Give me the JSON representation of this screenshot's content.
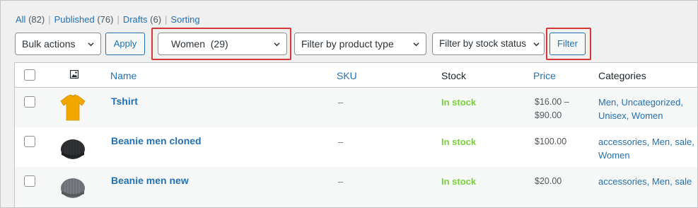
{
  "status_links": {
    "all": {
      "label": "All",
      "count": "(82)"
    },
    "published": {
      "label": "Published",
      "count": "(76)"
    },
    "drafts": {
      "label": "Drafts",
      "count": "(6)"
    },
    "sorting": {
      "label": "Sorting"
    },
    "separator": "|"
  },
  "toolbar": {
    "bulk_actions": "Bulk actions",
    "apply": "Apply",
    "category_filter": "Women  (29)",
    "product_type_filter": "Filter by product type",
    "stock_status_filter": "Filter by stock status",
    "filter": "Filter"
  },
  "table": {
    "headers": {
      "name": "Name",
      "sku": "SKU",
      "stock": "Stock",
      "price": "Price",
      "categories": "Categories"
    },
    "rows": [
      {
        "name": "Tshirt",
        "sku": "–",
        "stock": "In stock",
        "price_line1": "$16.00 –",
        "price_line2": "$90.00",
        "categories_line1": "Men, Uncategorized,",
        "categories_line2": "Unisex, Women",
        "thumb": "tshirt-thumbnail"
      },
      {
        "name": "Beanie men cloned",
        "sku": "–",
        "stock": "In stock",
        "price_line1": "$100.00",
        "price_line2": "",
        "categories_line1": "accessories, Men, sale,",
        "categories_line2": "Women",
        "thumb": "beanie-dark-thumbnail"
      },
      {
        "name": "Beanie men new",
        "sku": "–",
        "stock": "In stock",
        "price_line1": "$20.00",
        "price_line2": "",
        "categories_line1": "accessories, Men, sale",
        "categories_line2": "",
        "thumb": "beanie-gray-thumbnail"
      }
    ]
  },
  "colors": {
    "link": "#2271b1",
    "in_stock": "#7ad03a",
    "highlight": "#d63638",
    "tshirt": "#f0a800"
  }
}
